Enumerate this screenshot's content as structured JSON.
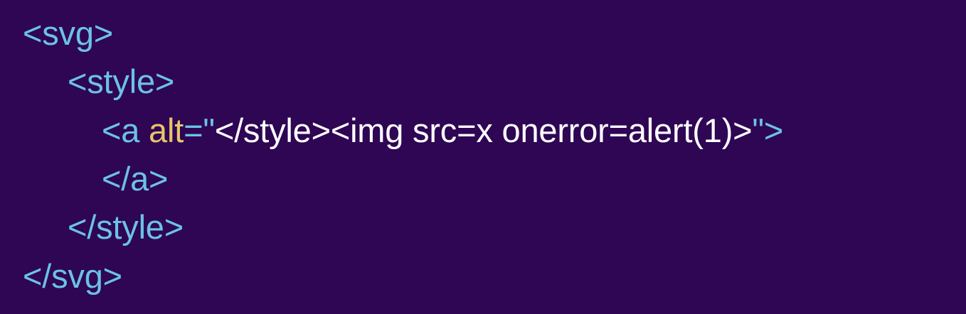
{
  "colors": {
    "background": "#2e0654",
    "tag": "#6cc2e3",
    "attribute": "#e9c46a",
    "string": "#ffffff"
  },
  "code": {
    "line1": {
      "tag": "<svg>"
    },
    "line2": {
      "tag": "<style>"
    },
    "line3": {
      "tag_open": "<a ",
      "attr_name": "alt",
      "equals_quote": "=\"",
      "attr_value": "</style><img src=x onerror=alert(1)>",
      "close_quote_gt": "\">"
    },
    "line4": {
      "tag": "</a>"
    },
    "line5": {
      "tag": "</style>"
    },
    "line6": {
      "tag": "</svg>"
    }
  }
}
